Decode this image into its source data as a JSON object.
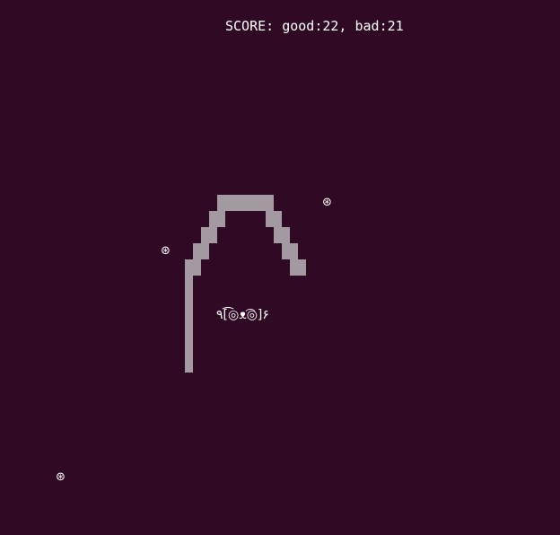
{
  "score": {
    "text": "SCORE: good:22, bad:21"
  },
  "player": {
    "face": "٩[͡◎ᴥ͡◎]۶"
  },
  "pickups": {
    "symbol": "⊛",
    "count": 3
  },
  "colors": {
    "background": "#300a24",
    "snake": "#a39aa1",
    "text": "#ffffff"
  }
}
